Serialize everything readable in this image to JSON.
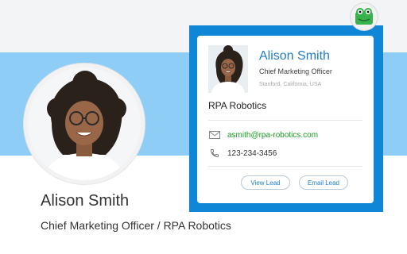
{
  "profile": {
    "name": "Alison Smith",
    "subtitle": "Chief Marketing Officer / RPA Robotics"
  },
  "card": {
    "name": "Alison Smith",
    "title": "Chief Marketing Officer",
    "location": "Stanford, California, USA",
    "company": "RPA Robotics",
    "email": "asmith@rpa-robotics.com",
    "phone": "123-234-3456",
    "buttons": {
      "view": "View Lead",
      "email": "Email Lead"
    }
  },
  "icons": {
    "extension": "frog-logo-icon",
    "email": "mail-icon",
    "phone": "phone-icon"
  },
  "colors": {
    "banner": "#8ecdf6",
    "popup_frame": "#0f86d6",
    "name_link": "#1f7cc8",
    "email_link": "#1a9a22"
  }
}
